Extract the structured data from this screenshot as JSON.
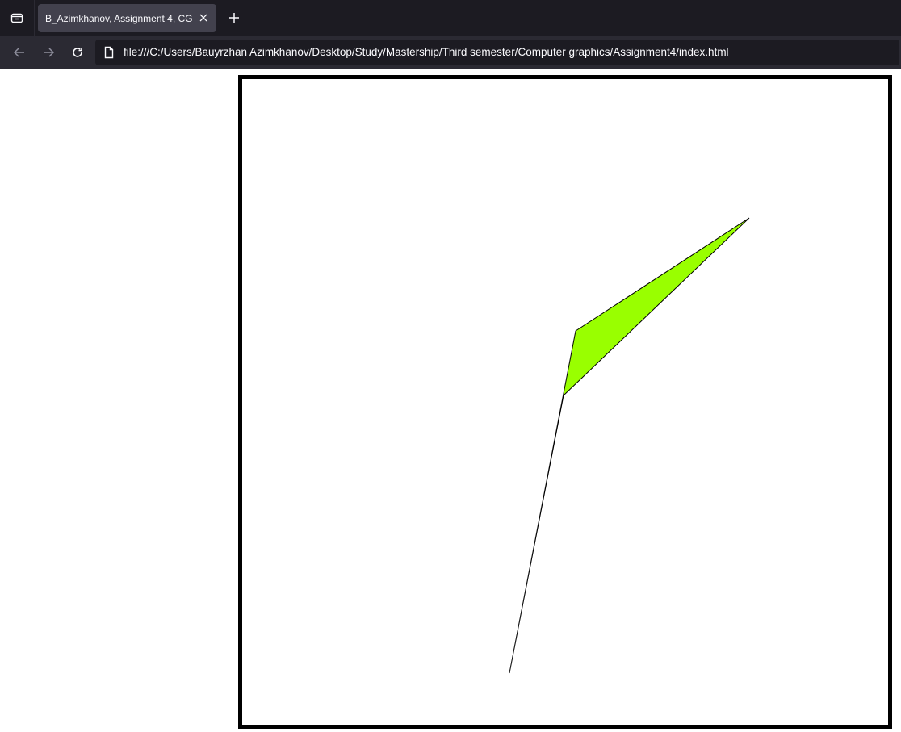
{
  "browser": {
    "tab": {
      "title": "B_Azimkhanov, Assignment 4, CG"
    },
    "address_bar": {
      "url": "file:///C:/Users/Bauyrzhan Azimkhanov/Desktop/Study/Mastership/Third semester/Computer graphics/Assignment4/index.html"
    },
    "icons": {
      "tab_list": "tab-list-icon",
      "close_tab": "close-icon",
      "new_tab": "plus-icon",
      "back": "back-arrow-icon",
      "forward": "forward-arrow-icon",
      "reload": "reload-icon",
      "page": "page-icon"
    },
    "theme": {
      "tabbar_bg": "#1c1b22",
      "navbar_bg": "#2b2a33",
      "active_tab_bg": "#42414d",
      "text": "#fbfbfe"
    }
  },
  "page": {
    "canvas": {
      "border_color": "#000000",
      "background": "#ffffff",
      "shape": {
        "kind": "quadrilateral",
        "fill": "#99ff00",
        "stroke": "#000000"
      }
    }
  }
}
